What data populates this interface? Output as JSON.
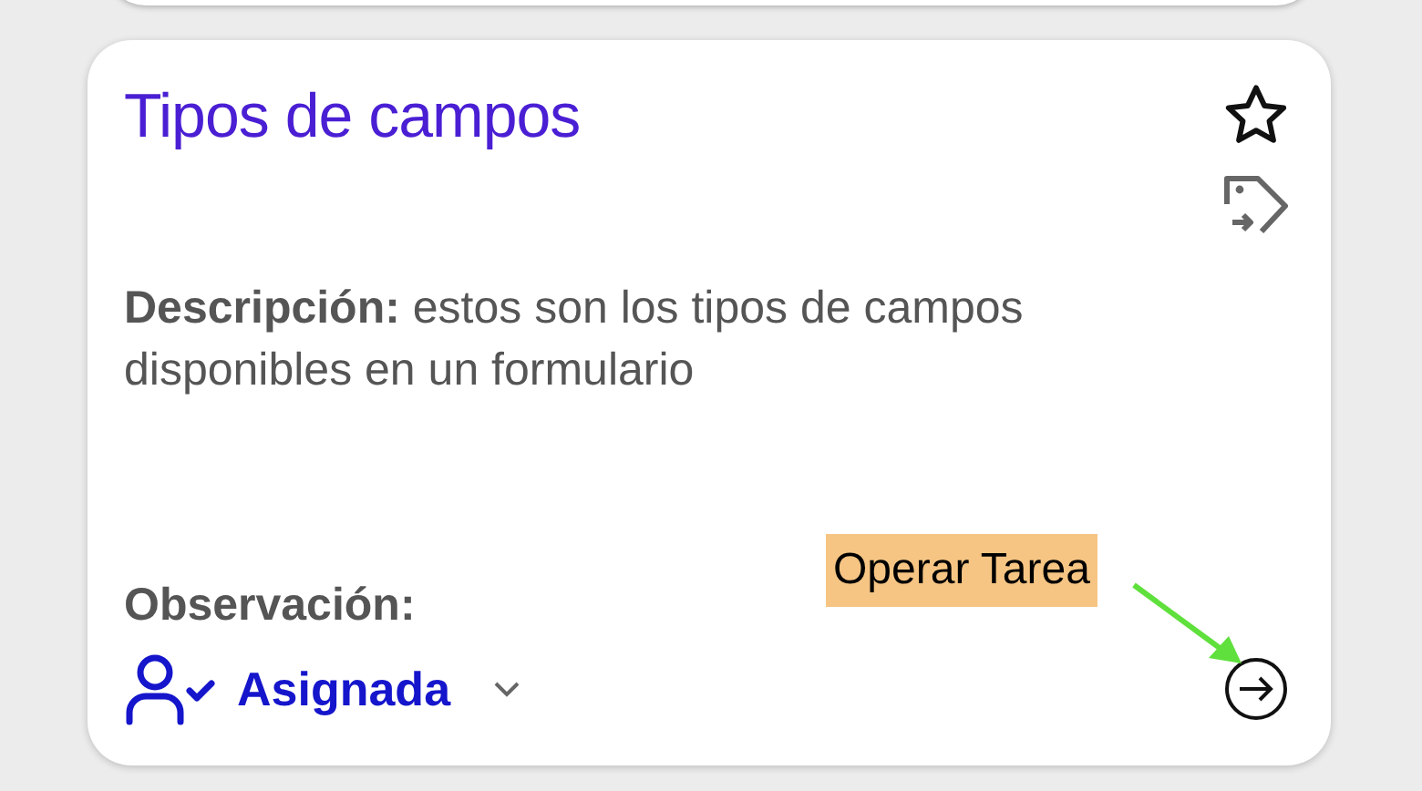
{
  "card": {
    "title": "Tipos de campos",
    "description": "**Descripción:** estos son los tipos de campos disponibles en un formulario",
    "observation_label": "Observación:",
    "status": "Asignada"
  },
  "annotation": {
    "label": "Operar Tarea"
  }
}
